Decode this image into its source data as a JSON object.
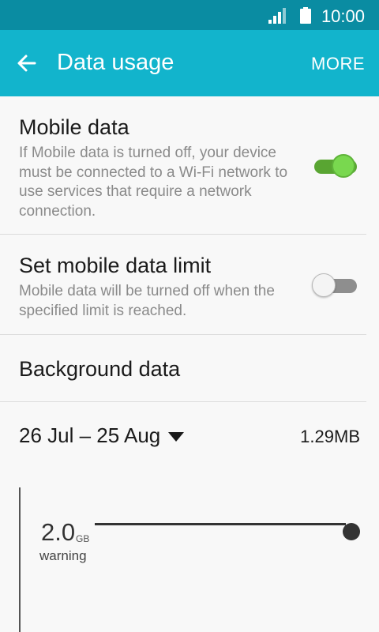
{
  "status_bar": {
    "time": "10:00",
    "signal_icon": "signal-icon",
    "battery_icon": "battery-icon"
  },
  "app_bar": {
    "title": "Data usage",
    "more_label": "MORE",
    "back_icon": "arrow-left-icon"
  },
  "settings": {
    "mobile_data": {
      "label": "Mobile data",
      "description": "If Mobile data is turned off, your device must be connected to a Wi-Fi network to use services that require a network connection.",
      "enabled": true
    },
    "data_limit": {
      "label": "Set mobile data limit",
      "description": "Mobile data will be turned off when the specified limit is reached.",
      "enabled": false
    },
    "background_data": {
      "label": "Background data"
    }
  },
  "cycle": {
    "range": "26 Jul – 25 Aug",
    "usage": "1.29MB"
  },
  "warning": {
    "value": "2.0",
    "unit": "GB",
    "label": "warning"
  },
  "colors": {
    "status_bar": "#0a8ca2",
    "app_bar": "#12b4cc",
    "toggle_on": "#79d84f"
  }
}
